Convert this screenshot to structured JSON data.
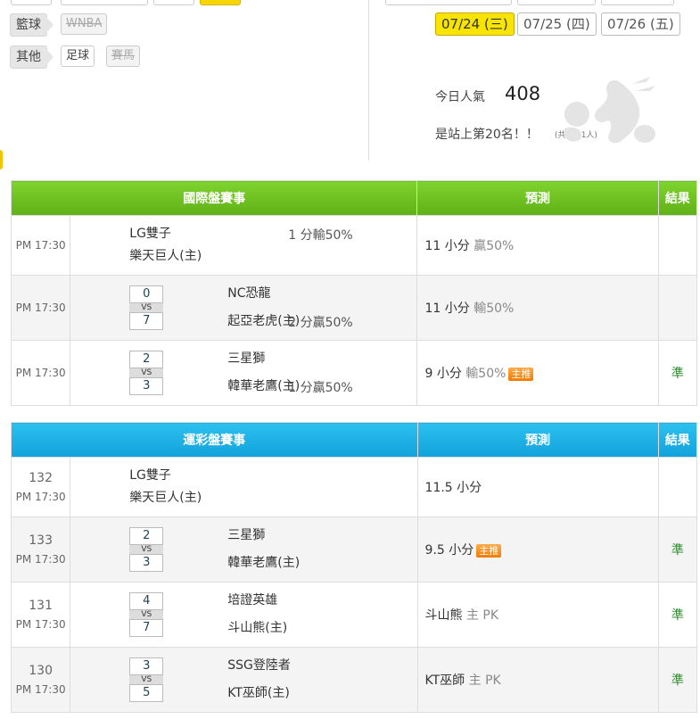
{
  "filters": {
    "basketball_label": "籃球",
    "wnba": "WNBA",
    "other_label": "其他",
    "soccer": "足球",
    "horse": "賽馬"
  },
  "dates": [
    "07/24 (三)",
    "07/25 (四)",
    "07/26 (五)"
  ],
  "popularity": {
    "label": "今日人氣",
    "value": "408",
    "rank_text": "是站上第20名！！",
    "total": "(共4591人)"
  },
  "intl_table": {
    "headers": [
      "國際盤賽事",
      "預測",
      "結果"
    ],
    "rows": [
      {
        "time": "PM 17:30",
        "away": "LG雙子",
        "home": "樂天巨人(主)",
        "spread": "1 分輸50%",
        "pred_main": "11 小分",
        "pred_sub": "贏50%",
        "badge": "",
        "result": ""
      },
      {
        "time": "PM 17:30",
        "score_away": "0",
        "vs": "VS",
        "score_home": "7",
        "away": "NC恐龍",
        "home": "起亞老虎(主)",
        "spread": "2 分贏50%",
        "pred_main": "11 小分",
        "pred_sub": "輸50%",
        "badge": "",
        "result": ""
      },
      {
        "time": "PM 17:30",
        "score_away": "2",
        "vs": "VS",
        "score_home": "3",
        "away": "三星獅",
        "home": "韓華老鷹(主)",
        "spread": "1 分贏50%",
        "pred_main": "9 小分",
        "pred_sub": "輸50%",
        "badge": "主推",
        "result": "準"
      }
    ]
  },
  "lottery_table": {
    "headers": [
      "運彩盤賽事",
      "預測",
      "結果"
    ],
    "rows": [
      {
        "num": "132",
        "time": "PM 17:30",
        "away": "LG雙子",
        "home": "樂天巨人(主)",
        "pred_main": "11.5 小分",
        "pred_sub": "",
        "badge": "",
        "result": ""
      },
      {
        "num": "133",
        "time": "PM 17:30",
        "score_away": "2",
        "vs": "VS",
        "score_home": "3",
        "away": "三星獅",
        "home": "韓華老鷹(主)",
        "pred_main": "9.5 小分",
        "pred_sub": "",
        "badge": "主推",
        "result": "準"
      },
      {
        "num": "131",
        "time": "PM 17:30",
        "score_away": "4",
        "vs": "VS",
        "score_home": "7",
        "away": "培證英雄",
        "home": "斗山熊(主)",
        "pred_main": "斗山熊",
        "pred_sub": "主 PK",
        "badge": "",
        "result": "準"
      },
      {
        "num": "130",
        "time": "PM 17:30",
        "score_away": "3",
        "vs": "VS",
        "score_home": "5",
        "away": "SSG登陸者",
        "home": "KT巫師(主)",
        "pred_main": "KT巫師",
        "pred_sub": "主 PK",
        "badge": "",
        "result": "準"
      }
    ]
  }
}
